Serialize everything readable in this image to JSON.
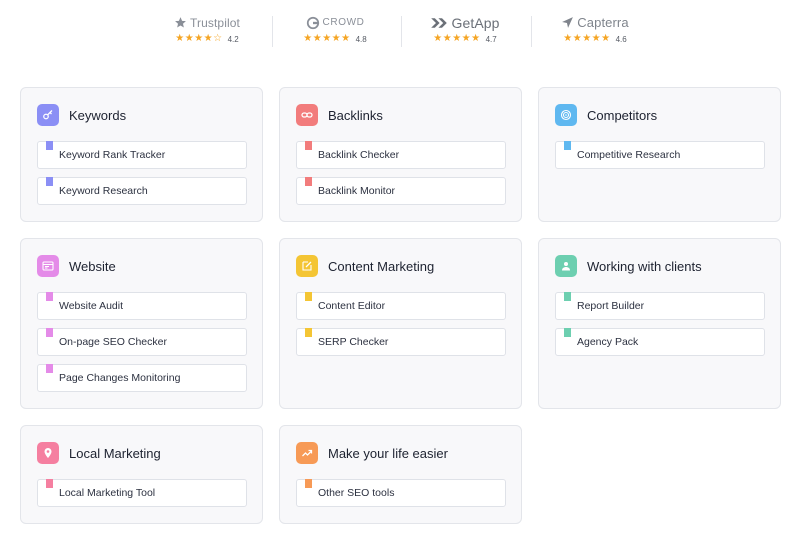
{
  "ratings": [
    {
      "name": "Trustpilot",
      "stars": "★★★★☆",
      "score": "4.2",
      "icon": "star-icon"
    },
    {
      "name": "CROWD",
      "stars": "★★★★★",
      "score": "4.8",
      "icon": "g2-icon"
    },
    {
      "name": "GetApp",
      "stars": "★★★★★",
      "score": "4.7",
      "icon": "getapp-icon"
    },
    {
      "name": "Capterra",
      "stars": "★★★★★",
      "score": "4.6",
      "icon": "capterra-icon"
    }
  ],
  "categories": [
    {
      "title": "Keywords",
      "color": "#8b8ff5",
      "icon": "key-icon",
      "tools": [
        "Keyword Rank Tracker",
        "Keyword Research"
      ]
    },
    {
      "title": "Backlinks",
      "color": "#f27c7c",
      "icon": "link-icon",
      "tools": [
        "Backlink Checker",
        "Backlink Monitor"
      ]
    },
    {
      "title": "Competitors",
      "color": "#5fb8f0",
      "icon": "target-icon",
      "tools": [
        "Competitive Research"
      ]
    },
    {
      "title": "Website",
      "color": "#e48be8",
      "icon": "browser-icon",
      "tools": [
        "Website Audit",
        "On-page SEO Checker",
        "Page Changes Monitoring"
      ]
    },
    {
      "title": "Content Marketing",
      "color": "#f4c534",
      "icon": "edit-icon",
      "tools": [
        "Content Editor",
        "SERP Checker"
      ]
    },
    {
      "title": "Working with clients",
      "color": "#6dcfb0",
      "icon": "user-icon",
      "tools": [
        "Report Builder",
        "Agency Pack"
      ]
    },
    {
      "title": "Local Marketing",
      "color": "#f57fa0",
      "icon": "location-pin-icon",
      "tools": [
        "Local Marketing Tool"
      ]
    },
    {
      "title": "Make your life easier",
      "color": "#f79a56",
      "icon": "trend-up-icon",
      "tools": [
        "Other SEO tools"
      ]
    }
  ]
}
